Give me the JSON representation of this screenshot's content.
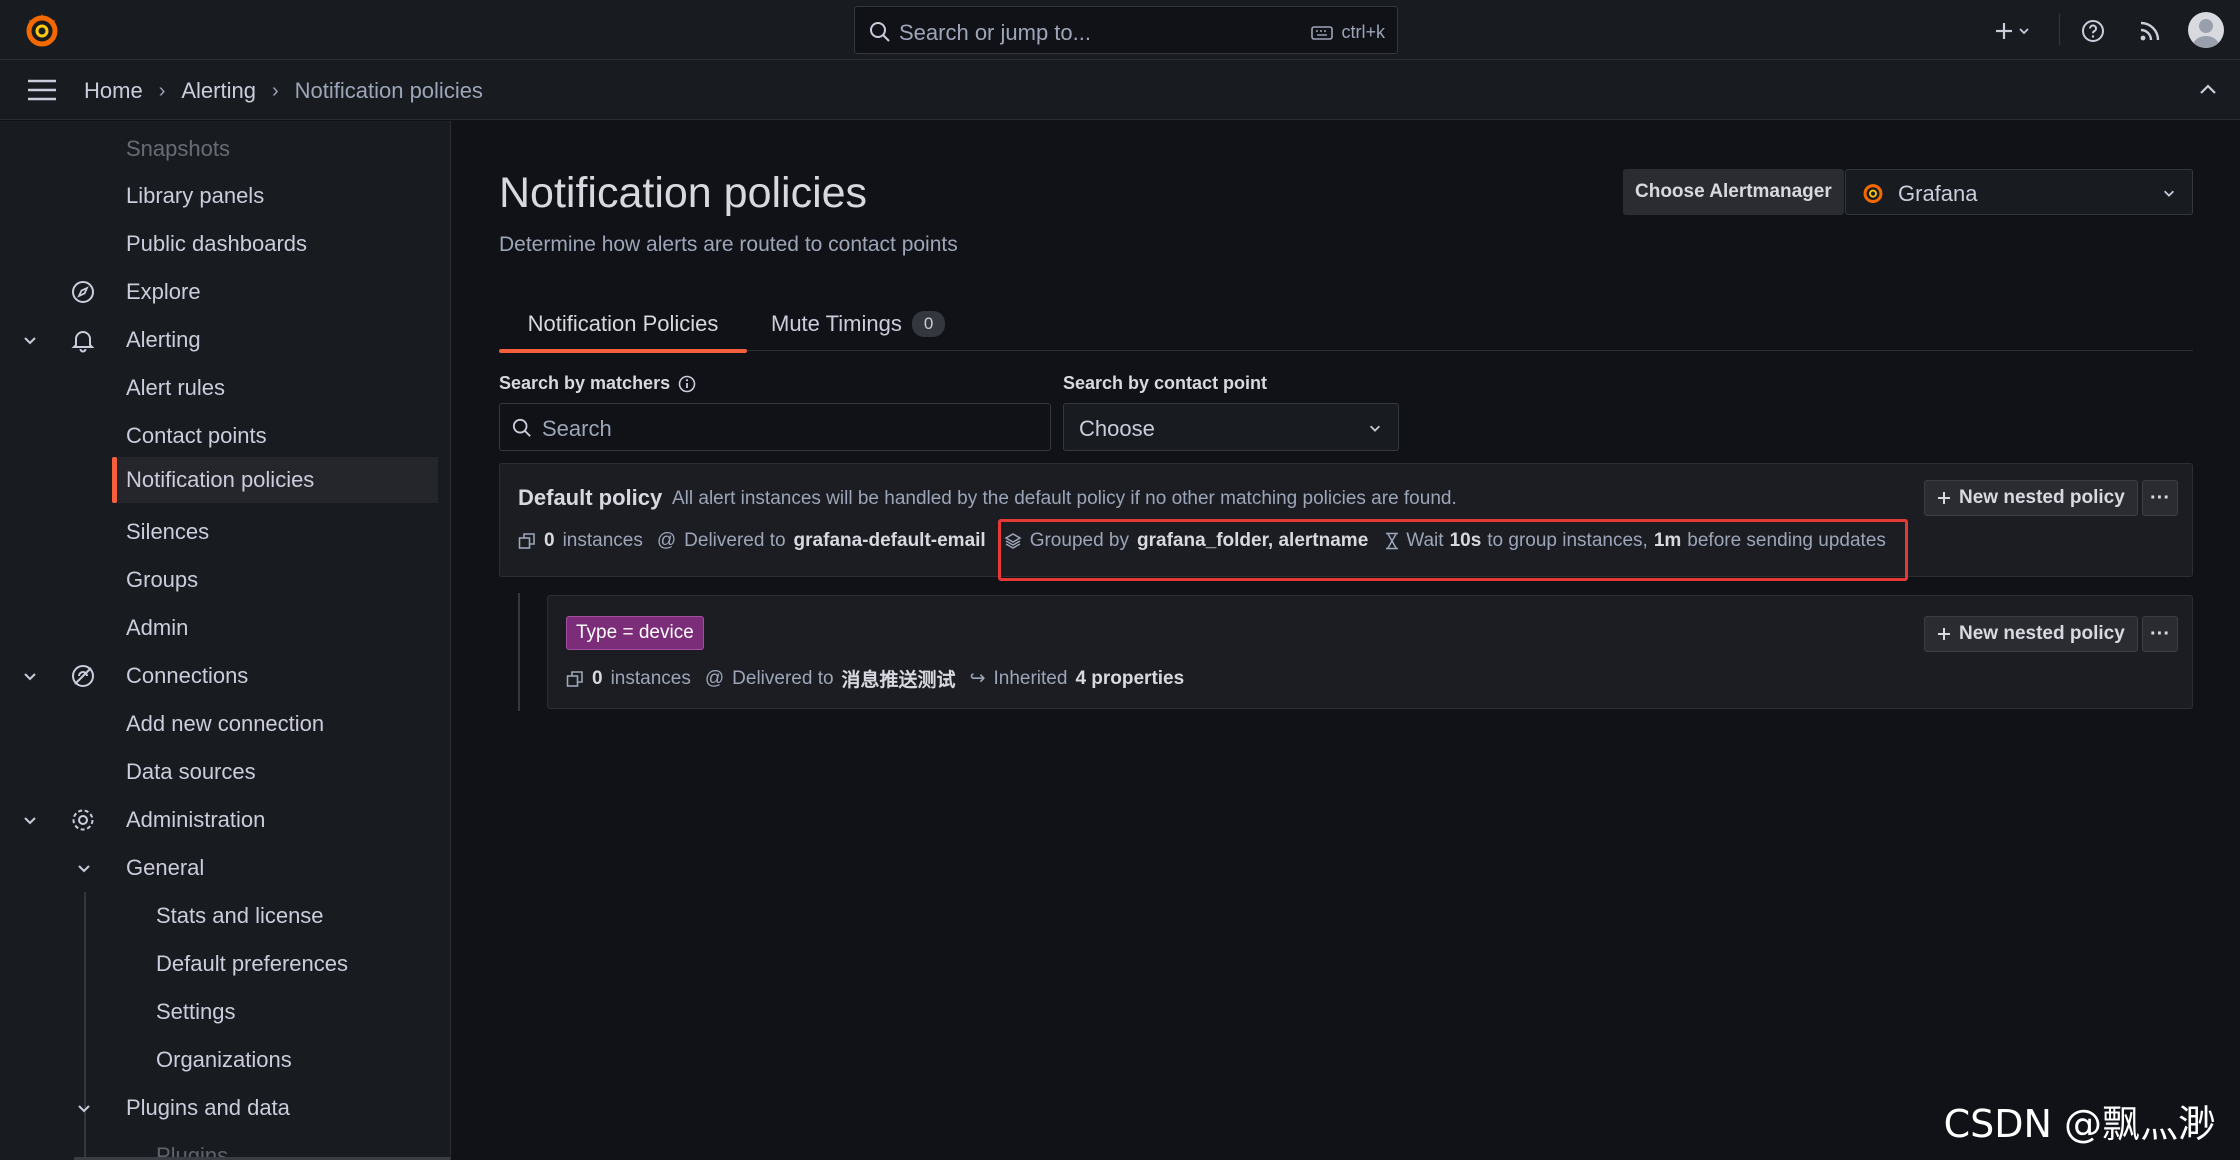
{
  "topbar": {
    "search_placeholder": "Search or jump to...",
    "search_shortcut": "ctrl+k"
  },
  "breadcrumb": [
    "Home",
    "Alerting",
    "Notification policies"
  ],
  "sidebar": {
    "items": [
      {
        "label": "Snapshots",
        "faded": true
      },
      {
        "label": "Library panels"
      },
      {
        "label": "Public dashboards"
      },
      {
        "label": "Explore",
        "icon": "compass-icon"
      },
      {
        "label": "Alerting",
        "icon": "bell-icon",
        "expanded": true
      },
      {
        "label": "Alert rules"
      },
      {
        "label": "Contact points"
      },
      {
        "label": "Notification policies",
        "active": true
      },
      {
        "label": "Silences"
      },
      {
        "label": "Groups"
      },
      {
        "label": "Admin"
      },
      {
        "label": "Connections",
        "icon": "connections-icon",
        "expanded": true
      },
      {
        "label": "Add new connection"
      },
      {
        "label": "Data sources"
      },
      {
        "label": "Administration",
        "icon": "gear-icon",
        "expanded": true
      },
      {
        "label": "General",
        "expanded": true
      },
      {
        "label": "Stats and license"
      },
      {
        "label": "Default preferences"
      },
      {
        "label": "Settings"
      },
      {
        "label": "Organizations"
      },
      {
        "label": "Plugins and data",
        "expanded": true
      },
      {
        "label": "Plugins",
        "faded": true
      }
    ]
  },
  "page": {
    "title": "Notification policies",
    "subtitle": "Determine how alerts are routed to contact points",
    "alertmanager_label": "Choose Alertmanager",
    "alertmanager_value": "Grafana"
  },
  "tabs": [
    {
      "label": "Notification Policies",
      "active": true
    },
    {
      "label": "Mute Timings",
      "count": "0"
    }
  ],
  "filters": {
    "matchers_label": "Search by matchers",
    "matchers_placeholder": "Search",
    "contact_label": "Search by contact point",
    "contact_value": "Choose"
  },
  "default_policy": {
    "title": "Default policy",
    "description": "All alert instances will be handled by the default policy if no other matching policies are found.",
    "instances_count": "0",
    "instances_label": "instances",
    "delivered_label": "Delivered to",
    "delivered_value": "grafana-default-email",
    "grouped_label": "Grouped by",
    "grouped_value": "grafana_folder, alertname",
    "wait_label": "Wait",
    "wait_value": "10s",
    "wait_mid": "to group instances,",
    "interval_value": "1m",
    "interval_suffix": "before sending updates",
    "new_nested_label": "New nested policy",
    "more_label": "···"
  },
  "nested_policy": {
    "matcher": "Type = device",
    "instances_count": "0",
    "instances_label": "instances",
    "delivered_label": "Delivered to",
    "delivered_value": "消息推送测试",
    "inherited_label": "Inherited",
    "inherited_value": "4 properties",
    "new_nested_label": "New nested policy",
    "more_label": "···"
  },
  "watermark": "CSDN @飘灬渺",
  "colors": {
    "accent": "#f55f3e",
    "highlight": "#e53935",
    "tag": "#7b2d7a"
  }
}
